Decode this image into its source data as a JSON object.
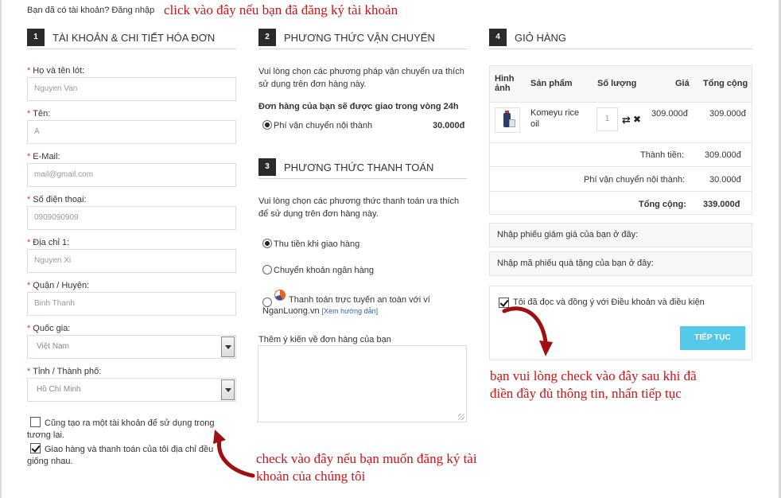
{
  "login": {
    "prompt": "Bạn đã có tài khoản? Đăng nhập"
  },
  "annotations": {
    "top": "click vào đây nếu bạn đã đăng ký tài khoản",
    "bottom": "check vào đây nếu bạn muốn đăng ký tài khoản của chúng tôi",
    "right": "bạn vui lòng check vào đây sau khi đã điền đầy đủ thông tin, nhấn tiếp tục"
  },
  "section1": {
    "number": "1",
    "title": "TÀI KHOẢN & CHI TIẾT HÓA ĐƠN",
    "fields": {
      "lastname": {
        "label": "Họ và tên lót:",
        "placeholder": "Nguyen Van"
      },
      "firstname": {
        "label": "Tên:",
        "placeholder": "A"
      },
      "email": {
        "label": "E-Mail:",
        "placeholder": "mail@gmail.com"
      },
      "phone": {
        "label": "Số điện thoại:",
        "placeholder": "0909090909"
      },
      "address": {
        "label": "Địa chỉ 1:",
        "placeholder": "Nguyen Xi"
      },
      "district": {
        "label": "Quận / Huyện:",
        "placeholder": "Binh Thanh"
      },
      "country": {
        "label": "Quốc gia:",
        "value": "Việt Nam"
      },
      "province": {
        "label": "Tỉnh / Thành phố:",
        "value": "Hồ Chí Minh"
      }
    },
    "create_account": {
      "label": "Cũng tạo ra một tài khoản để sử dụng trong tương lai.",
      "checked": false
    },
    "same_address": {
      "label": "Giao hàng và thanh toán của tôi địa chỉ đều giống nhau.",
      "checked": true
    }
  },
  "section2": {
    "number": "2",
    "title": "PHƯƠNG THỨC VẬN CHUYỂN",
    "intro": "Vui lòng chọn các phương pháp vận chuyển ưa thích sử dụng trên đơn hàng này.",
    "delivery_note": "Đơn hàng của bạn sẽ được giao trong vòng 24h",
    "option": {
      "label": "Phí vận chuyển nội thành",
      "price": "30.000đ",
      "selected": true
    }
  },
  "section3": {
    "number": "3",
    "title": "PHƯƠNG THỨC THANH TOÁN",
    "intro": "Vui lòng chọn các phương thức thanh toán ưa thích để sử dụng trên đơn hàng này.",
    "options": [
      {
        "label": "Thu tiền khi giao hàng",
        "selected": true
      },
      {
        "label": "Chuyển khoản ngân hàng",
        "selected": false
      },
      {
        "label": "Thanh toán trực tuyến an toàn với ví",
        "label2": "NganLuong.vn",
        "link": "[Xem hướng dẫn]",
        "selected": false
      }
    ],
    "comment_label": "Thêm ý kiến về đơn hàng của bạn"
  },
  "section4": {
    "number": "4",
    "title": "GIỎ HÀNG",
    "columns": {
      "image_1": "Hình",
      "image_2": "ảnh",
      "product": "Sản phẩm",
      "qty": "Số lượng",
      "price": "Giá",
      "total": "Tổng cộng"
    },
    "item": {
      "name_1": "Komeyu rice",
      "name_2": "oil",
      "qty": "1",
      "price": "309.000đ",
      "total": "309.000đ"
    },
    "subtotal": {
      "label": "Thành tiền:",
      "value": "309.000đ"
    },
    "shipping": {
      "label": "Phí vận chuyển nội thành:",
      "value": "30.000đ"
    },
    "grand_total": {
      "label": "Tổng cộng:",
      "value": "339.000đ"
    },
    "coupon": "Nhập phiếu giảm giá của bạn ở đây:",
    "voucher": "Nhập mã phiếu quà tặng của bạn ở đây:",
    "agree": {
      "label": "Tôi đã đọc và đồng ý với Điều khoản và điều kiện",
      "checked": true
    },
    "continue_button": "TIẾP TỤC"
  },
  "colors": {
    "annotation": "#cc1414",
    "button": "#55c8ea",
    "step_badge": "#2b2b2b"
  }
}
